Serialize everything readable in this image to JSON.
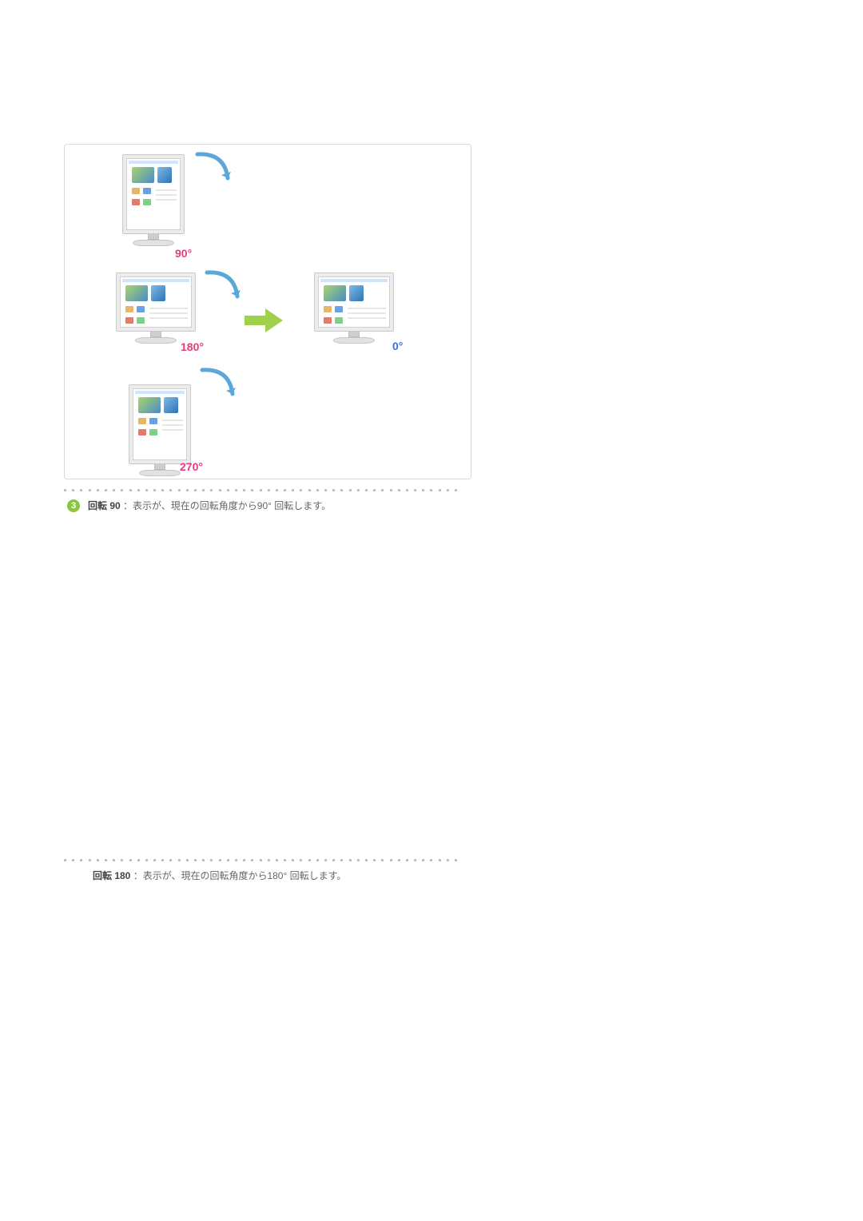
{
  "items": [
    {
      "badge": "3",
      "title": "回転 90",
      "desc": "：表示が、現在の回転角度から90° 回転します。"
    },
    {
      "title": "回転 180",
      "desc": "：表示が、現在の回転角度から180° 回転します。"
    }
  ],
  "figure": {
    "labels": {
      "d90": "90°",
      "d180": "180°",
      "d270": "270°",
      "d0": "0°"
    }
  }
}
